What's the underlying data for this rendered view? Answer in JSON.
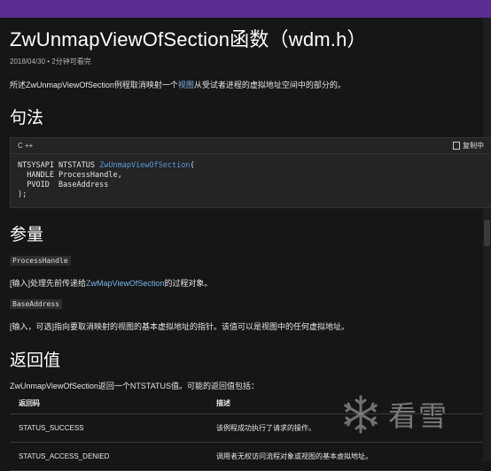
{
  "header": {
    "title": "ZwUnmapViewOfSection函数（wdm.h）",
    "meta": "2018/04/30 • 2分钟可看完"
  },
  "intro": {
    "before": "所述",
    "fn": "ZwUnmapViewOfSection",
    "mid": "例程取消映射一个",
    "link": "视图",
    "after": "从受试者进程的虚拟地址空间中的部分的。"
  },
  "syntax": {
    "heading": "句法",
    "lang": "C ++",
    "copy_label": "复制中",
    "code": {
      "prefix": "NTSYSAPI NTSTATUS ",
      "fn": "ZwUnmapViewOfSection",
      "open": "(",
      "line2": "  HANDLE ProcessHandle,",
      "line3": "  PVOID  BaseAddress",
      "line4": ");"
    }
  },
  "params": {
    "heading": "参量",
    "p1": {
      "name": "ProcessHandle",
      "desc_before": "[输入]处理先前传递给",
      "desc_link": "ZwMapViewOfSection",
      "desc_after": "的过程对象。"
    },
    "p2": {
      "name": "BaseAddress",
      "desc": "[输入，可选]指向要取消映射的视图的基本虚拟地址的指针。该值可以是视图中的任何虚拟地址。"
    }
  },
  "returns": {
    "heading": "返回值",
    "intro": "ZwUnmapViewOfSection返回一个NTSTATUS值。可能的返回值包括：",
    "col_code": "返回码",
    "col_desc": "描述",
    "rows": [
      {
        "code": "STATUS_SUCCESS",
        "desc": "该例程成功执行了请求的操作。"
      },
      {
        "code": "STATUS_ACCESS_DENIED",
        "desc": "调用者无权访问流程对象或视图的基本虚拟地址。"
      }
    ]
  },
  "watermark": {
    "text": "看雪"
  },
  "colors": {
    "accent": "#5c2d91",
    "link": "#75b6e7",
    "code_fn": "#569cd6",
    "background": "#161616"
  }
}
